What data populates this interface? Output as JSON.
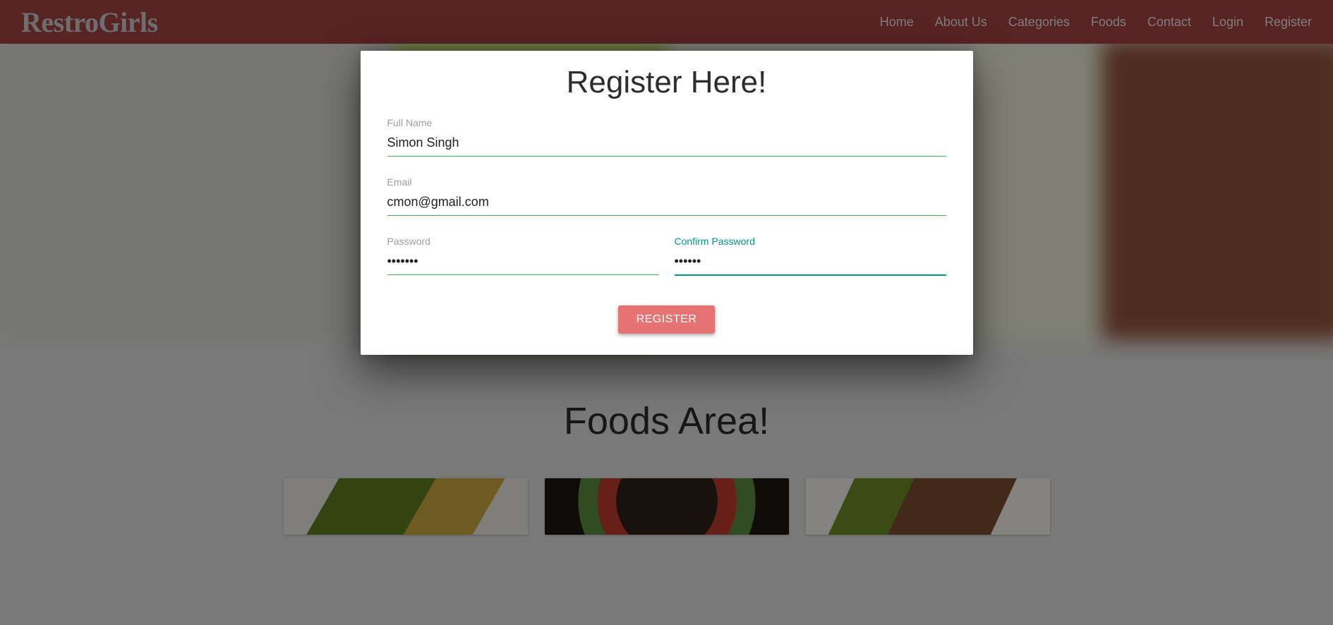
{
  "brand": "RestroGirls",
  "nav": {
    "home": "Home",
    "about": "About Us",
    "categories": "Categories",
    "foods": "Foods",
    "contact": "Contact",
    "login": "Login",
    "register": "Register"
  },
  "modal": {
    "title": "Register Here!",
    "fullNameLabel": "Full Name",
    "fullNameValue": "Simon Singh",
    "emailLabel": "Email",
    "emailValue": "cmon@gmail.com",
    "passwordLabel": "Password",
    "passwordValue": "•••••••",
    "confirmPasswordLabel": "Confirm Password",
    "confirmPasswordValue": "••••••",
    "submitLabel": "REGISTER"
  },
  "section": {
    "title": "Foods Area!"
  }
}
